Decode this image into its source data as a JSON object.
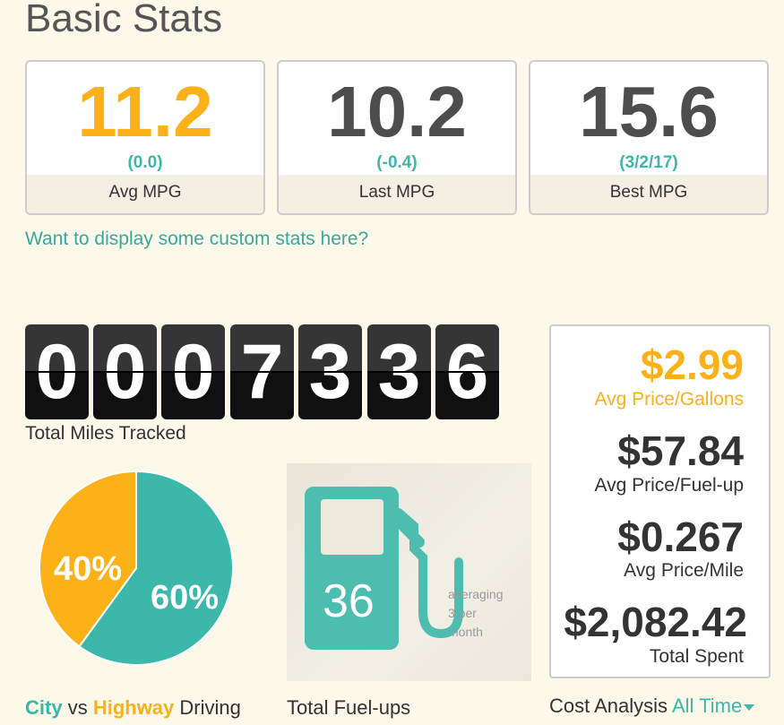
{
  "title": "Basic Stats",
  "stats": [
    {
      "value": "11.2",
      "delta": "(0.0)",
      "label": "Avg MPG"
    },
    {
      "value": "10.2",
      "delta": "(-0.4)",
      "label": "Last MPG"
    },
    {
      "value": "15.6",
      "delta": "(3/2/17)",
      "label": "Best MPG"
    }
  ],
  "custom_stats_link": "Want to display some custom stats here?",
  "odometer": {
    "digits": [
      "0",
      "0",
      "0",
      "7",
      "3",
      "3",
      "6"
    ],
    "label": "Total Miles Tracked"
  },
  "driving": {
    "city_pct": 60,
    "highway_pct": 40,
    "city_text": "60%",
    "highway_text": "40%",
    "city_word": "City",
    "vs_word": "vs",
    "highway_word": "Highway",
    "driving_word": "Driving",
    "colors": {
      "city": "#3bb8aa",
      "highway": "#fbb117"
    }
  },
  "fuelups": {
    "count": "36",
    "averaging": "averaging",
    "rate": "3 per",
    "period": "month",
    "label": "Total Fuel-ups"
  },
  "cost": [
    {
      "value": "$2.99",
      "label": "Avg Price/Gallons"
    },
    {
      "value": "$57.84",
      "label": "Avg Price/Fuel-up"
    },
    {
      "value": "$0.267",
      "label": "Avg Price/Mile"
    },
    {
      "value": "$2,082.42",
      "label": "Total Spent"
    }
  ],
  "cost_footer": {
    "label": "Cost Analysis",
    "range": "All Time"
  }
}
